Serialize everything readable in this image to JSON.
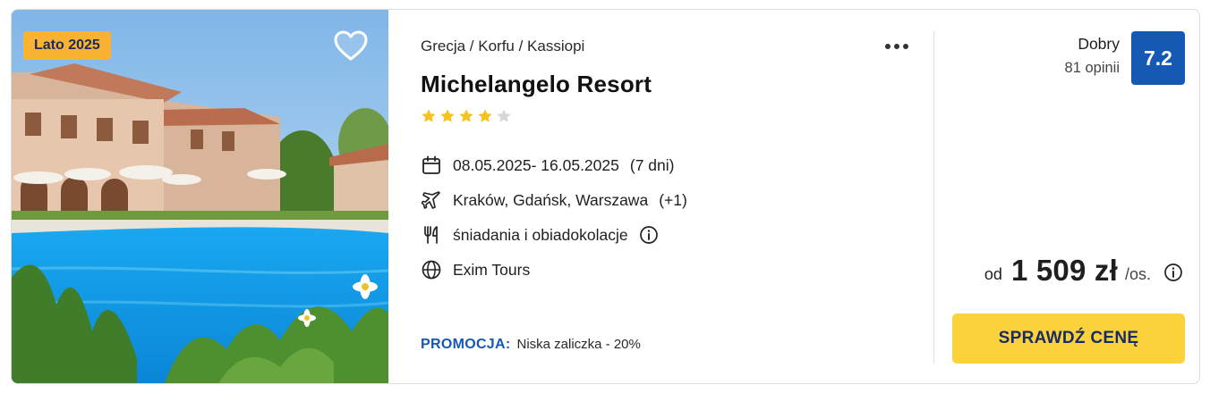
{
  "photo": {
    "badge": "Lato 2025",
    "icons": {
      "favorite": "heart-outline-icon"
    }
  },
  "offer": {
    "breadcrumb": "Grecja / Korfu / Kassiopi",
    "more_icon": "more-dots-icon",
    "hotel_name": "Michelangelo Resort",
    "stars": {
      "filled": 4,
      "total": 5
    },
    "dates": "08.05.2025- 16.05.2025",
    "duration": "(7 dni)",
    "departures": "Kraków, Gdańsk, Warszawa",
    "departures_extra": "(+1)",
    "board": "śniadania i obiadokolacje",
    "operator": "Exim Tours",
    "promo_label": "PROMOCJA:",
    "promo_text": "Niska zaliczka - 20%",
    "icons": [
      "calendar-icon",
      "plane-icon",
      "cutlery-icon",
      "info-icon",
      "globe-icon"
    ]
  },
  "rating": {
    "label": "Dobry",
    "count": "81 opinii",
    "score": "7.2"
  },
  "price": {
    "from": "od",
    "amount": "1 509 zł",
    "unit": "/os."
  },
  "cta": {
    "label": "SPRAWDŹ CENĘ"
  },
  "colors": {
    "badge": "#f9b233",
    "accent_blue": "#1559b5",
    "cta": "#fcd23c",
    "star": "#f6c21c",
    "star_empty": "#d7d7d7"
  }
}
